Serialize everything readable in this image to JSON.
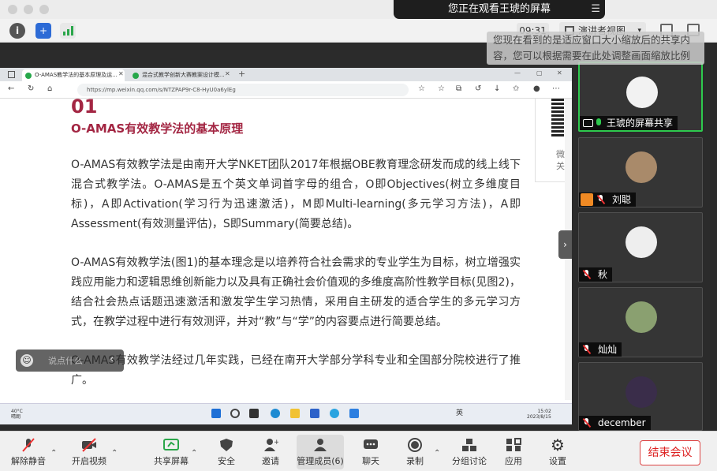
{
  "banner": {
    "title": "您正在观看王琥的屏幕",
    "menu_icon": "menu-icon"
  },
  "toolbar": {
    "timer": "09:31",
    "view_label": "演讲者视图"
  },
  "notice": {
    "line1": "您现在看到的是适应窗口大小缩放后的共享内",
    "line2": "容，您可以根据需要在此处调整画面缩放比例"
  },
  "browser": {
    "tab1": "O-AMAS教学法的基本原理及运...",
    "tab2": "混合式教学创新大赛教案设计模...",
    "url": "https://mp.weixin.qq.com/s/NTZPAP9r-C8-HyU0a6ylEg"
  },
  "article": {
    "number": "01",
    "heading": "O-AMAS有效教学法的基本原理",
    "p1": "O-AMAS有效教学法是由南开大学NKET团队2017年根据OBE教育理念研发而成的线上线下混合式教学法。O-AMAS是五个英文单词首字母的组合，O即Objectives(树立多维度目标)，A即Activation(学习行为迅速激活)，M即Multi-learning(多元学习方法)，A即Assessment(有效测量评估)，S即Summary(简要总结)。",
    "p2": "O-AMAS有效教学法(图1)的基本理念是以培养符合社会需求的专业学生为目标，树立增强实践应用能力和逻辑思维创新能力以及具有正确社会价值观的多维度高阶性教学目标(见图2)，结合社会热点话题迅速激活和激发学生学习热情，采用自主研发的适合学生的多元学习方式，在教学过程中进行有效测评，并对“教”与“学”的内容要点进行简要总结。",
    "p3": "O-AMAS有效教学法经过几年实践，已经在南开大学部分学科专业和全国部分院校进行了推广。"
  },
  "side": {
    "line1": "微",
    "line2": "关"
  },
  "chat": {
    "placeholder": "说点什么"
  },
  "taskbar": {
    "weather_temp": "40°C",
    "weather_desc": "晴朗",
    "ime": "英",
    "time": "15:02",
    "date": "2023/8/15"
  },
  "participants": [
    {
      "name": "王琥的屏幕共享"
    },
    {
      "name": "刘聪"
    },
    {
      "name": "秋"
    },
    {
      "name": "灿灿"
    },
    {
      "name": "december"
    }
  ],
  "bottom": {
    "mute": "解除静音",
    "video": "开启视频",
    "share": "共享屏幕",
    "security": "安全",
    "invite": "邀请",
    "members": "管理成员(6)",
    "chat": "聊天",
    "record": "录制",
    "breakout": "分组讨论",
    "apps": "应用",
    "settings": "设置",
    "end": "结束会议"
  },
  "colors": {
    "accent_red": "#a32643",
    "active_green": "#2ec94e",
    "end_red": "#dd2222"
  }
}
